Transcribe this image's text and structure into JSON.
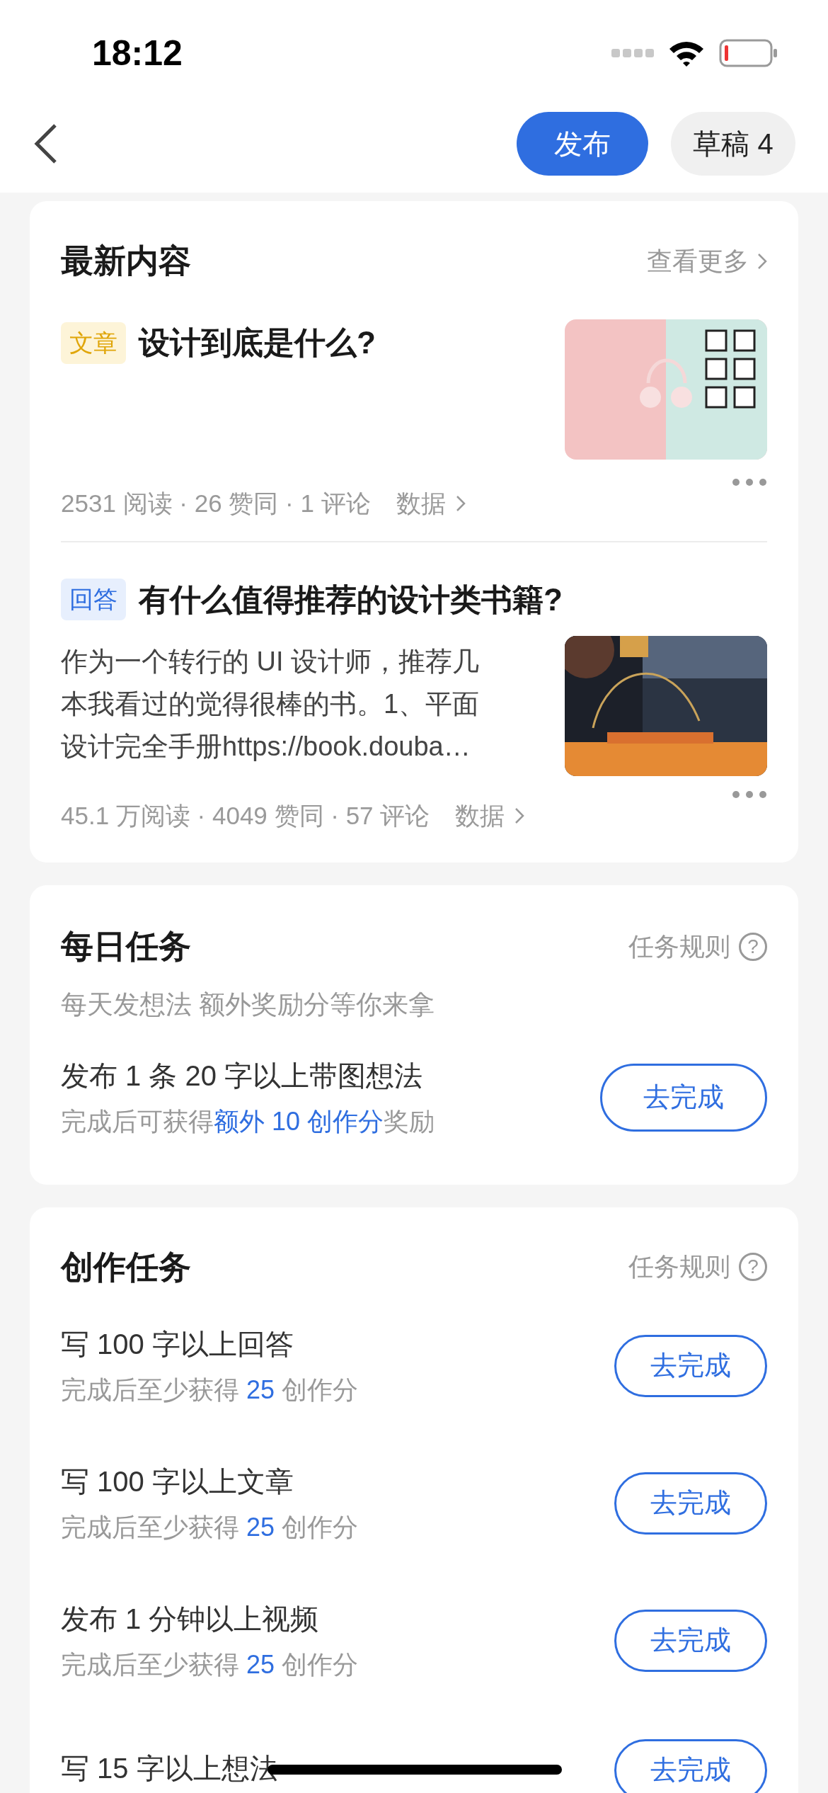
{
  "status_bar": {
    "time": "18:12"
  },
  "nav": {
    "publish_button": "发布",
    "drafts_button": "草稿 4"
  },
  "latest": {
    "title": "最新内容",
    "more_link": "查看更多",
    "items": [
      {
        "kind": "article",
        "tag": "文章",
        "title": "设计到底是什么?",
        "stats": "2531 阅读 · 26 赞同 · 1 评论",
        "data_link": "数据",
        "picture": {
          "kind": "picture"
        }
      },
      {
        "kind": "answer",
        "tag": "回答",
        "title": "有什么值得推荐的设计类书籍?",
        "excerpt_lines": [
          "作为一个转行的 UI 设计师，推荐几",
          "本我看过的觉得很棒的书。1、平面",
          "设计完全手册https://book.douba…"
        ],
        "stats": "45.1 万阅读 · 4049 赞同 · 57 评论",
        "data_link": "数据",
        "picture": {
          "kind": "picture"
        }
      }
    ]
  },
  "daily": {
    "title": "每日任务",
    "rules_link": "任务规则",
    "help_icon": "?",
    "subtitle": "每天发想法 额外奖励分等你来拿",
    "task": {
      "title": "发布 1 条 20 字以上带图想法",
      "reward_prefix": "完成后可获得",
      "reward_highlight": "额外 10 创作分",
      "reward_suffix": "奖励",
      "button": "去完成"
    }
  },
  "creation": {
    "title": "创作任务",
    "rules_link": "任务规则",
    "help_icon": "?",
    "tasks": [
      {
        "title": "写 100 字以上回答",
        "reward_prefix": "完成后至少获得 ",
        "reward_highlight": "25",
        "reward_suffix": " 创作分",
        "button": "去完成"
      },
      {
        "title": "写 100 字以上文章",
        "reward_prefix": "完成后至少获得 ",
        "reward_highlight": "25",
        "reward_suffix": " 创作分",
        "button": "去完成"
      },
      {
        "title": "发布 1 分钟以上视频",
        "reward_prefix": "完成后至少获得 ",
        "reward_highlight": "25",
        "reward_suffix": " 创作分",
        "button": "去完成"
      },
      {
        "title": "写 15 字以上想法",
        "button": "去完成"
      }
    ]
  }
}
